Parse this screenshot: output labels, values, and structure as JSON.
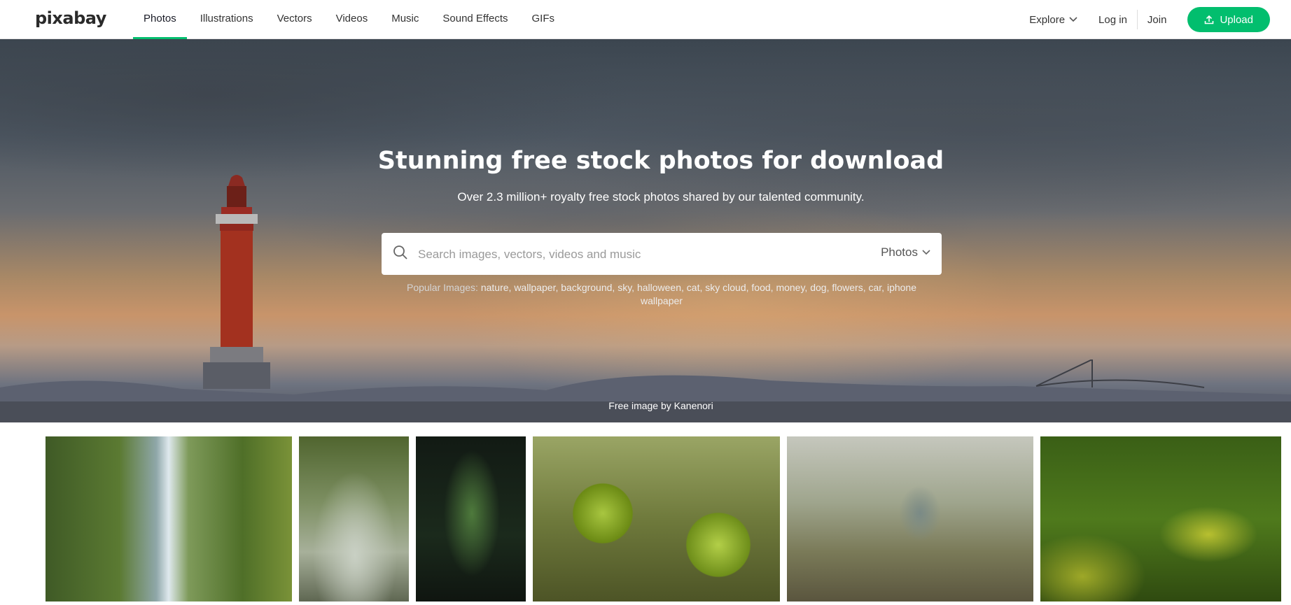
{
  "brand": {
    "logo": "pixabay",
    "accent": "#02be6e"
  },
  "nav": {
    "items": [
      {
        "label": "Photos",
        "active": true
      },
      {
        "label": "Illustrations"
      },
      {
        "label": "Vectors"
      },
      {
        "label": "Videos"
      },
      {
        "label": "Music"
      },
      {
        "label": "Sound Effects"
      },
      {
        "label": "GIFs"
      }
    ],
    "explore": "Explore",
    "login": "Log in",
    "join": "Join",
    "upload": "Upload"
  },
  "hero": {
    "title": "Stunning free stock photos for download",
    "subtitle": "Over 2.3 million+ royalty free stock photos shared by our talented community.",
    "search": {
      "placeholder": "Search images, vectors, videos and music",
      "type_selected": "Photos"
    },
    "popular_label": "Popular Images:",
    "popular_tags": [
      "nature",
      "wallpaper",
      "background",
      "sky",
      "halloween",
      "cat",
      "sky cloud",
      "food",
      "money",
      "dog",
      "flowers",
      "car",
      "iphone wallpaper"
    ],
    "credit": "Free image by Kanenori"
  },
  "gallery": [
    {
      "subject": "waterfall"
    },
    {
      "subject": "forest path"
    },
    {
      "subject": "fern"
    },
    {
      "subject": "green tomatoes"
    },
    {
      "subject": "hummingbird"
    },
    {
      "subject": "butterfly on goldenrod"
    }
  ]
}
